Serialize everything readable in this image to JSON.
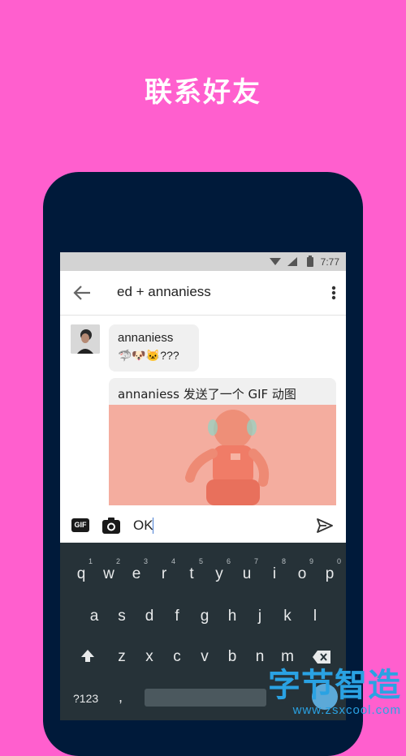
{
  "headline": "联系好友",
  "status_bar": {
    "time": "7:77"
  },
  "app_bar": {
    "title": "ed + annaniess"
  },
  "messages": [
    {
      "sender": "annaniess",
      "text": "🦈🐶🐱???"
    },
    {
      "caption": "annaniess 发送了一个 GIF 动图"
    }
  ],
  "composer": {
    "gif_label": "GIF",
    "input_value": "OK"
  },
  "keyboard": {
    "row1": [
      {
        "key": "q",
        "hint": "1"
      },
      {
        "key": "w",
        "hint": "2"
      },
      {
        "key": "e",
        "hint": "3"
      },
      {
        "key": "r",
        "hint": "4"
      },
      {
        "key": "t",
        "hint": "5"
      },
      {
        "key": "y",
        "hint": "6"
      },
      {
        "key": "u",
        "hint": "7"
      },
      {
        "key": "i",
        "hint": "8"
      },
      {
        "key": "o",
        "hint": "9"
      },
      {
        "key": "p",
        "hint": "0"
      }
    ],
    "row2": [
      "a",
      "s",
      "d",
      "f",
      "g",
      "h",
      "j",
      "k",
      "l"
    ],
    "row3": [
      "z",
      "x",
      "c",
      "v",
      "b",
      "n",
      "m"
    ],
    "symbols_label": "?123",
    "comma_label": ","
  },
  "watermark": {
    "chinese": "字节智造",
    "url": "www.zsxcool.com"
  },
  "colors": {
    "background": "#ff5fce",
    "phone": "#001a3a",
    "keyboard": "#263238",
    "watermark": "#2aa2e3"
  }
}
